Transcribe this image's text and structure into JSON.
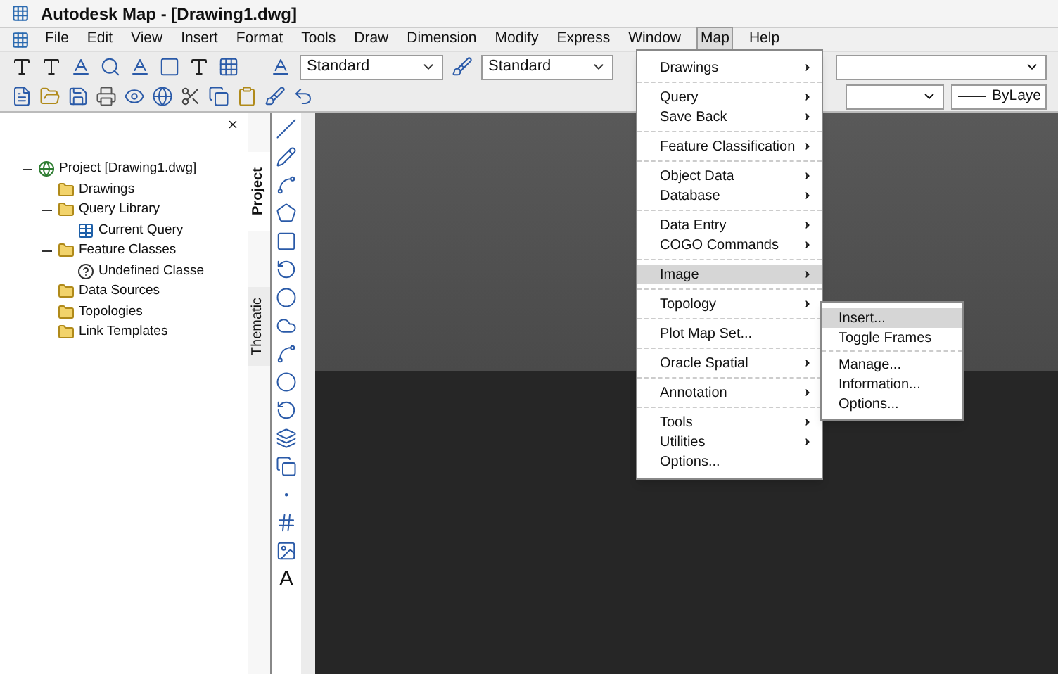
{
  "window": {
    "title": "Autodesk Map - [Drawing1.dwg]"
  },
  "menu_bar": [
    {
      "label": "File",
      "selected": false
    },
    {
      "label": "Edit",
      "selected": false
    },
    {
      "label": "View",
      "selected": false
    },
    {
      "label": "Insert",
      "selected": false
    },
    {
      "label": "Format",
      "selected": false
    },
    {
      "label": "Tools",
      "selected": false
    },
    {
      "label": "Draw",
      "selected": false
    },
    {
      "label": "Dimension",
      "selected": false
    },
    {
      "label": "Modify",
      "selected": false
    },
    {
      "label": "Express",
      "selected": false
    },
    {
      "label": "Window",
      "selected": false
    },
    {
      "label": "Map",
      "selected": true
    },
    {
      "label": "Help",
      "selected": false
    }
  ],
  "toolbar": {
    "text_style": "Standard",
    "dim_style": "Standard",
    "linetype": "ByLaye"
  },
  "panel": {
    "tree": [
      {
        "label": "Project [Drawing1.dwg]",
        "kind": "project",
        "expanded": true,
        "children": [
          {
            "label": "Drawings",
            "kind": "folder"
          },
          {
            "label": "Query Library",
            "kind": "folder",
            "expanded": true,
            "children": [
              {
                "label": "Current Query",
                "kind": "query"
              }
            ]
          },
          {
            "label": "Feature Classes",
            "kind": "folder",
            "expanded": true,
            "children": [
              {
                "label": "Undefined Classe",
                "kind": "unknown"
              }
            ]
          },
          {
            "label": "Data Sources",
            "kind": "folder"
          },
          {
            "label": "Topologies",
            "kind": "folder"
          },
          {
            "label": "Link Templates",
            "kind": "folder"
          }
        ]
      }
    ],
    "tabs": [
      {
        "label": "Project",
        "selected": true
      },
      {
        "label": "Thematic",
        "selected": false
      }
    ]
  },
  "draw_toolbar": {
    "text_tool": "A"
  },
  "map_menu": {
    "groups": [
      [
        {
          "label": "Drawings",
          "submenu": true,
          "selected": false
        }
      ],
      [
        {
          "label": "Query",
          "submenu": true,
          "selected": false
        },
        {
          "label": "Save Back",
          "submenu": true,
          "selected": false
        }
      ],
      [
        {
          "label": "Feature Classification",
          "submenu": true,
          "selected": false
        }
      ],
      [
        {
          "label": "Object Data",
          "submenu": true,
          "selected": false
        },
        {
          "label": "Database",
          "submenu": true,
          "selected": false
        }
      ],
      [
        {
          "label": "Data Entry",
          "submenu": true,
          "selected": false
        },
        {
          "label": "COGO Commands",
          "submenu": true,
          "selected": false
        }
      ],
      [
        {
          "label": "Image",
          "submenu": true,
          "selected": true
        }
      ],
      [
        {
          "label": "Topology",
          "submenu": true,
          "selected": false
        }
      ],
      [
        {
          "label": "Plot Map Set...",
          "submenu": false,
          "selected": false
        }
      ],
      [
        {
          "label": "Oracle Spatial",
          "submenu": true,
          "selected": false
        }
      ],
      [
        {
          "label": "Annotation",
          "submenu": true,
          "selected": false
        }
      ],
      [
        {
          "label": "Tools",
          "submenu": true,
          "selected": false
        },
        {
          "label": "Utilities",
          "submenu": true,
          "selected": false
        },
        {
          "label": "Options...",
          "submenu": false,
          "selected": false
        }
      ]
    ]
  },
  "image_submenu": {
    "groups": [
      [
        {
          "label": "Insert...",
          "selected": true
        },
        {
          "label": "Toggle Frames",
          "selected": false
        }
      ],
      [
        {
          "label": "Manage...",
          "selected": false
        },
        {
          "label": "Information...",
          "selected": false
        },
        {
          "label": "Options...",
          "selected": false
        }
      ]
    ]
  }
}
